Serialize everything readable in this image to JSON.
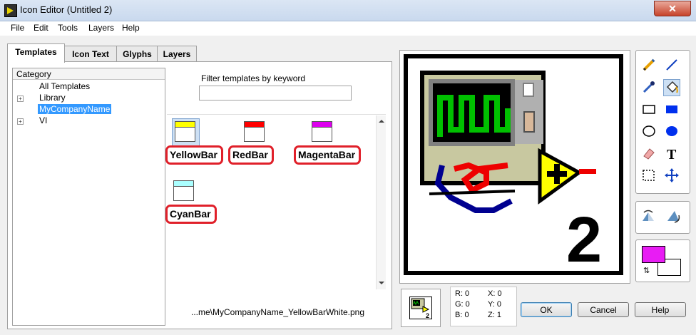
{
  "window": {
    "title": "Icon Editor (Untitled 2)",
    "close_label": "✕"
  },
  "menu": {
    "items": [
      "File",
      "Edit",
      "Tools",
      "Layers",
      "Help"
    ]
  },
  "tabs": [
    {
      "label": "Templates",
      "active": true
    },
    {
      "label": "Icon Text",
      "active": false
    },
    {
      "label": "Glyphs",
      "active": false
    },
    {
      "label": "Layers",
      "active": false
    }
  ],
  "category": {
    "header": "Category",
    "items": [
      {
        "label": "All Templates",
        "expander": false,
        "selected": false
      },
      {
        "label": "Library",
        "expander": true,
        "selected": false
      },
      {
        "label": "MyCompanyName",
        "expander": false,
        "selected": true
      },
      {
        "label": "VI",
        "expander": true,
        "selected": false
      }
    ]
  },
  "filter": {
    "label": "Filter templates by keyword",
    "value": "",
    "placeholder": ""
  },
  "templates": [
    {
      "name": "YellowBar",
      "bar_color": "#ffff00",
      "selected": true
    },
    {
      "name": "RedBar",
      "bar_color": "#ff0000",
      "selected": false
    },
    {
      "name": "MagentaBar",
      "bar_color": "#dd00ee",
      "selected": false
    },
    {
      "name": "CyanBar",
      "bar_color": "#aaffff",
      "selected": false
    }
  ],
  "file_path": "...me\\MyCompanyName_YellowBarWhite.png",
  "preview": {
    "glyph": "2"
  },
  "tools": [
    {
      "name": "pencil-icon",
      "selected": false
    },
    {
      "name": "line-icon",
      "selected": false
    },
    {
      "name": "color-picker-icon",
      "selected": false
    },
    {
      "name": "fill-bucket-icon",
      "selected": true
    },
    {
      "name": "rectangle-outline-icon",
      "selected": false
    },
    {
      "name": "rectangle-filled-icon",
      "selected": false
    },
    {
      "name": "ellipse-outline-icon",
      "selected": false
    },
    {
      "name": "ellipse-filled-icon",
      "selected": false
    },
    {
      "name": "eraser-icon",
      "selected": false
    },
    {
      "name": "text-tool-icon",
      "selected": false
    },
    {
      "name": "select-icon",
      "selected": false
    },
    {
      "name": "move-icon",
      "selected": false
    }
  ],
  "flip_tools": [
    "flip-horizontal-icon",
    "rotate-icon"
  ],
  "colors": {
    "foreground": "#e81cf4",
    "background": "#ffffff"
  },
  "pixel_info": {
    "r": "R: 0",
    "g": "G: 0",
    "b": "B: 0",
    "x": "X: 0",
    "y": "Y: 0",
    "z": "Z: 1"
  },
  "buttons": {
    "ok": "OK",
    "cancel": "Cancel",
    "help": "Help"
  }
}
